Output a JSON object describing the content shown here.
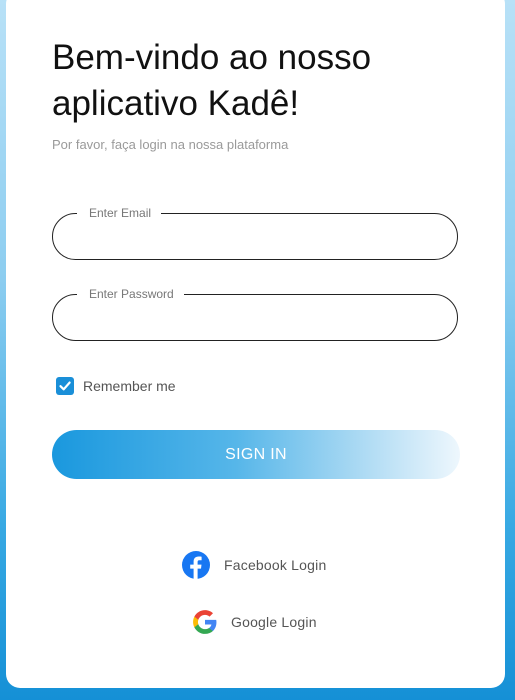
{
  "header": {
    "title": "Bem-vindo ao nosso aplicativo Kadê!",
    "subtitle": "Por favor, faça login na nossa plataforma"
  },
  "form": {
    "email": {
      "label": "Enter Email",
      "value": ""
    },
    "password": {
      "label": "Enter Password",
      "value": ""
    },
    "remember": {
      "label": "Remember me",
      "checked": true
    },
    "signin_label": "SIGN IN"
  },
  "social": {
    "facebook_label": "Facebook Login",
    "google_label": "Google Login"
  },
  "colors": {
    "accent": "#1a8fd8",
    "facebook": "#1877f2",
    "background_gradient_end": "#1590d6"
  },
  "icons": {
    "checkbox": "checkmark-icon",
    "facebook": "facebook-icon",
    "google": "google-icon"
  }
}
